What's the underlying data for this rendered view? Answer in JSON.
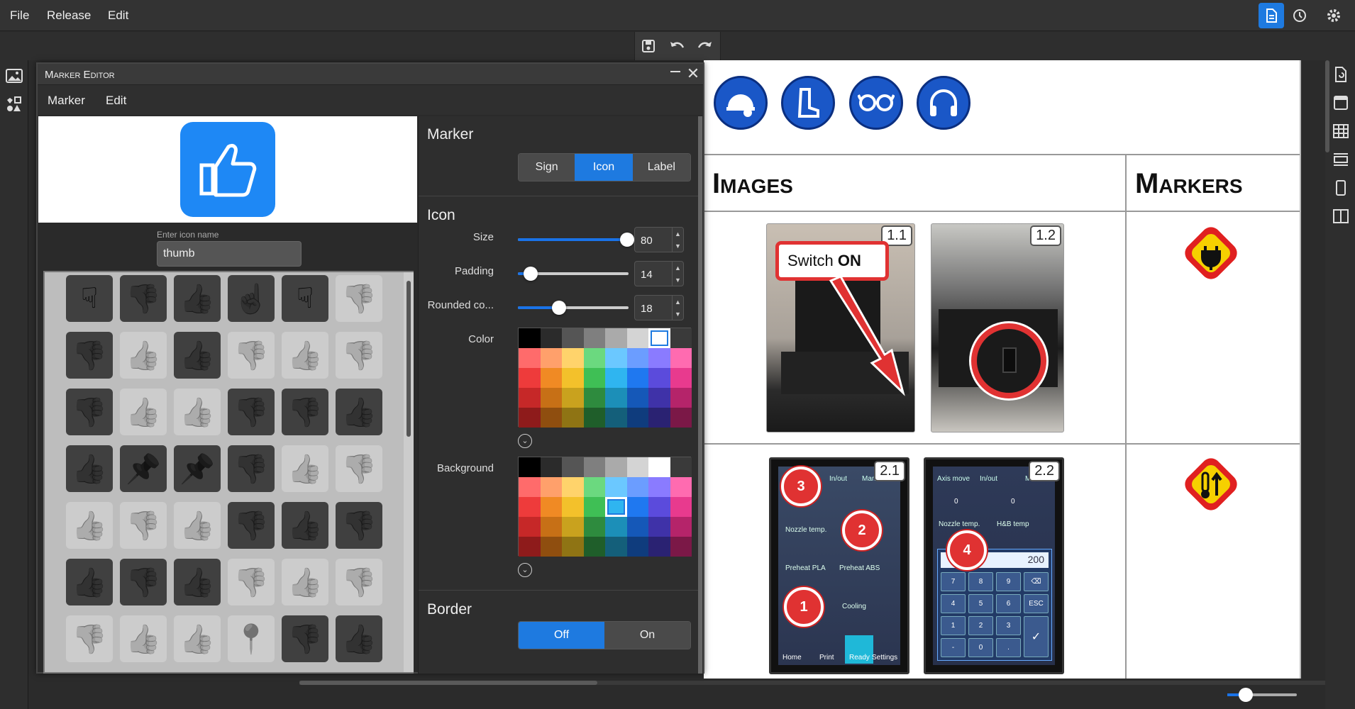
{
  "menubar": {
    "items": [
      "File",
      "Release",
      "Edit"
    ]
  },
  "editor": {
    "title": "Marker Editor",
    "menu": [
      "Marker",
      "Edit"
    ],
    "icon_name_label": "Enter icon name",
    "icon_name_value": "thumb",
    "marker_section": "Marker",
    "marker_tabs": [
      "Sign",
      "Icon",
      "Label"
    ],
    "marker_selected": "Icon",
    "icon_section": "Icon",
    "size_label": "Size",
    "size_value": "80",
    "size_fraction": 1.0,
    "padding_label": "Padding",
    "padding_value": "14",
    "padding_fraction": 0.1,
    "rounded_label": "Rounded co...",
    "rounded_value": "18",
    "rounded_fraction": 0.37,
    "color_label": "Color",
    "background_label": "Background",
    "border_section": "Border",
    "border_options": [
      "Off",
      "On"
    ],
    "border_selected": "Off",
    "preview_color": "#1e88f5",
    "grid_icons": [
      "hand-point-down",
      "thumbs-down",
      "thumbs-up",
      "hand-pointer",
      "hand-point-down",
      "thumbs-down-outline",
      "thumbs-down",
      "thumbs-up-outline",
      "thumbs-up",
      "thumbs-down-outline",
      "thumbs-up-outline",
      "thumbs-down-outline",
      "thumbs-down-left",
      "thumbs-up-outline",
      "thumbs-up-outline",
      "thumbs-down",
      "thumbs-down",
      "thumbs-up",
      "thumbs-up",
      "pushpin",
      "pushpin",
      "thumbs-down",
      "thumbs-up-outline",
      "thumbs-down-outline",
      "thumbs-up-outline",
      "thumbs-down-outline",
      "thumbs-up-outline",
      "thumbs-down",
      "thumbs-up",
      "thumbs-down-right",
      "thumbs-up-left",
      "thumbs-down",
      "thumbs-up",
      "thumbs-down-outline",
      "thumbs-up-outline",
      "thumbs-down-outline",
      "thumbs-down-outline",
      "thumbs-up-outline",
      "thumbs-up-outline",
      "pushpin-outline",
      "thumbs-down",
      "thumbs-up"
    ]
  },
  "document": {
    "header_images": "Images",
    "header_markers": "Markers",
    "row1": {
      "tag1": "1.1",
      "tag2": "1.2",
      "callout_text": "Switch ",
      "callout_bold": "ON"
    },
    "row2": {
      "tag1": "2.1",
      "tag2": "2.2",
      "pins": [
        "3",
        "2",
        "1",
        "4"
      ],
      "screen1": {
        "tabs": [
          "In/out",
          "Manual"
        ],
        "items": [
          "Nozzle temp.",
          "Preheat PLA",
          "Preheat ABS",
          "Cooling"
        ],
        "nav": [
          "Home",
          "Print",
          "Ready",
          "Settings"
        ]
      },
      "screen2": {
        "tabs": [
          "Axis move",
          "In/out",
          "Manual"
        ],
        "items": [
          "Nozzle temp.",
          "H&B temp"
        ],
        "zero1": "0",
        "zero2": "0",
        "entry": "200",
        "keys": [
          "7",
          "8",
          "9",
          "⌫",
          "4",
          "5",
          "6",
          "ESC",
          "1",
          "2",
          "3",
          "",
          "-",
          "0",
          "."
        ]
      }
    }
  },
  "palette": {
    "color": [
      [
        "#000000",
        "#2b2b2b",
        "#555555",
        "#7f7f7f",
        "#aaaaaa",
        "#d4d4d4",
        "#ffffff",
        "#3a3a3a"
      ],
      [
        "#ff6b6b",
        "#ffa06b",
        "#ffd36b",
        "#6bd97f",
        "#6bc8ff",
        "#6b9dff",
        "#8a7bff",
        "#ff6bb0"
      ],
      [
        "#ee3b3b",
        "#f08a24",
        "#f3c12b",
        "#3fbf55",
        "#2fb5f0",
        "#1f78f0",
        "#5b4bdc",
        "#e83a8e"
      ],
      [
        "#c62828",
        "#c77016",
        "#c9a21e",
        "#2e8b3e",
        "#1c8fb8",
        "#1558b8",
        "#3f32a8",
        "#b5246a"
      ],
      [
        "#8e1b1b",
        "#8f4e0f",
        "#8f7414",
        "#1f5e2a",
        "#145f7a",
        "#0f3c7d",
        "#2a2272",
        "#7b1847"
      ]
    ],
    "color_selected": [
      0,
      6
    ],
    "background_selected": [
      2,
      4
    ]
  }
}
